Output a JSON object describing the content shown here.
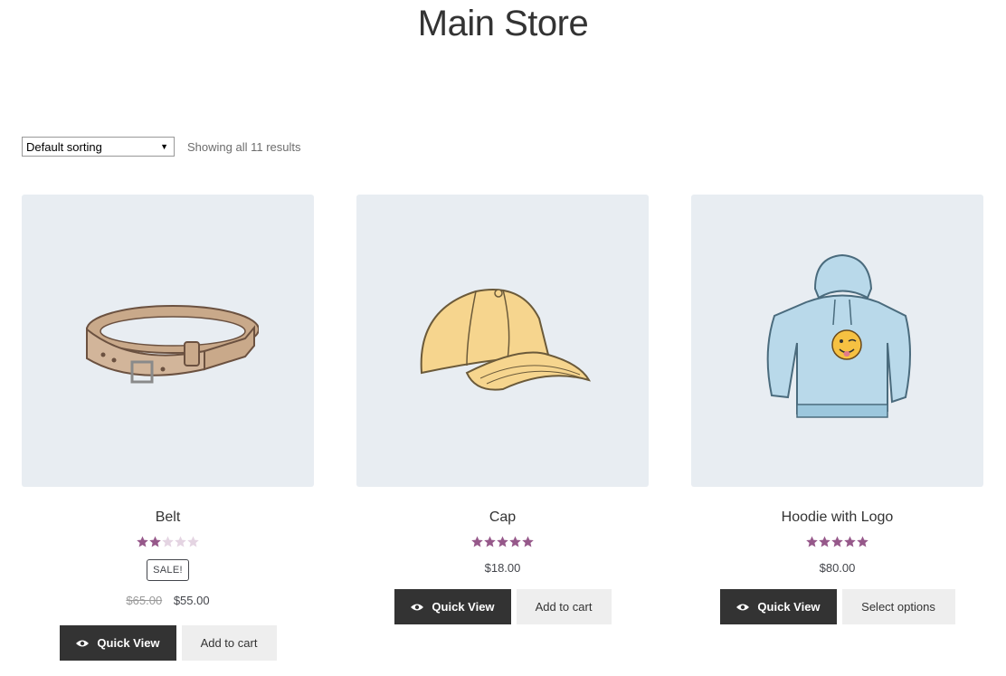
{
  "page": {
    "title": "Main Store"
  },
  "toolbar": {
    "sort_selected": "Default sorting",
    "result_count": "Showing all 11 results"
  },
  "colors": {
    "image_bg": "#e8edf2",
    "star_filled": "#96588a",
    "star_empty": "#e4d4e2",
    "dark_button": "#333333",
    "light_button": "#eeeeee"
  },
  "products": [
    {
      "name": "Belt",
      "rating": 2,
      "rating_max": 5,
      "sale_badge": "SALE!",
      "old_price": "$65.00",
      "price": "$55.00",
      "quick_view_label": "Quick View",
      "action_label": "Add to cart",
      "image_icon": "belt-illustration"
    },
    {
      "name": "Cap",
      "rating": 5,
      "rating_max": 5,
      "price": "$18.00",
      "quick_view_label": "Quick View",
      "action_label": "Add to cart",
      "image_icon": "cap-illustration"
    },
    {
      "name": "Hoodie with Logo",
      "rating": 5,
      "rating_max": 5,
      "price": "$80.00",
      "quick_view_label": "Quick View",
      "action_label": "Select options",
      "image_icon": "hoodie-illustration"
    }
  ]
}
